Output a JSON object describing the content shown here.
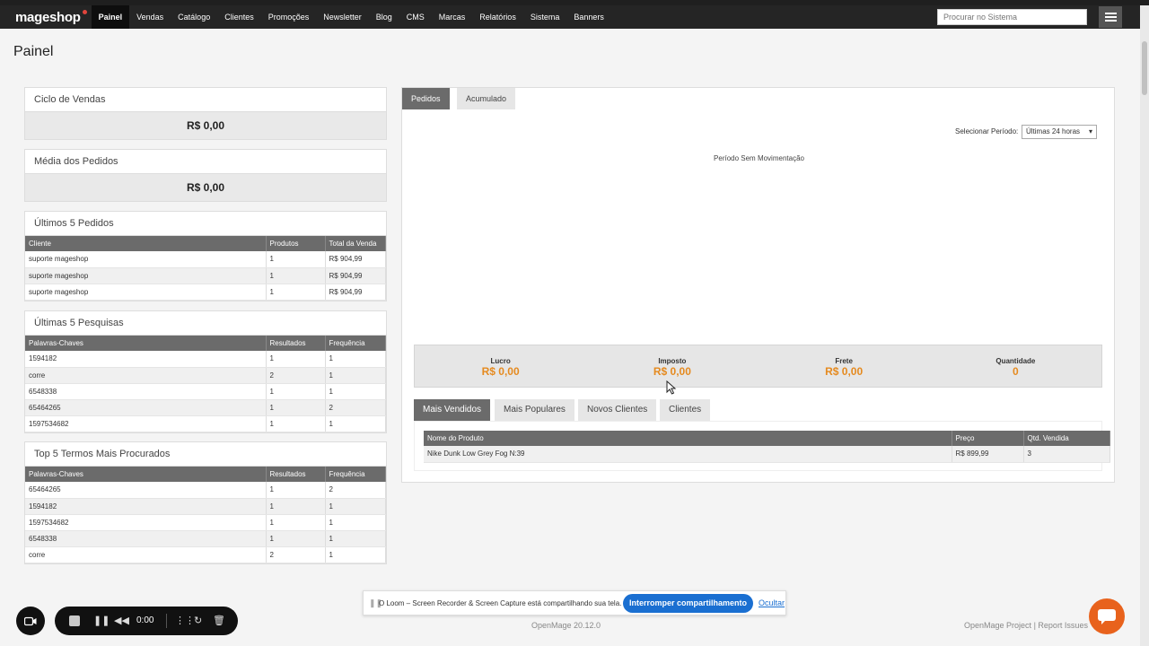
{
  "app": {
    "logo": "mageshop"
  },
  "nav": {
    "items": [
      "Painel",
      "Vendas",
      "Catálogo",
      "Clientes",
      "Promoções",
      "Newsletter",
      "Blog",
      "CMS",
      "Marcas",
      "Relatórios",
      "Sistema",
      "Banners"
    ],
    "active": "Painel",
    "search_placeholder": "Procurar no Sistema"
  },
  "page_title": "Painel",
  "sales_cycle": {
    "title": "Ciclo de Vendas",
    "value": "R$ 0,00"
  },
  "avg_orders": {
    "title": "Média dos Pedidos",
    "value": "R$ 0,00"
  },
  "last_orders": {
    "title": "Últimos 5 Pedidos",
    "columns": [
      "Cliente",
      "Produtos",
      "Total da Venda"
    ],
    "rows": [
      [
        "suporte mageshop",
        "1",
        "R$ 904,99"
      ],
      [
        "suporte mageshop",
        "1",
        "R$ 904,99"
      ],
      [
        "suporte mageshop",
        "1",
        "R$ 904,99"
      ]
    ]
  },
  "last_searches": {
    "title": "Últimas 5 Pesquisas",
    "columns": [
      "Palavras-Chaves",
      "Resultados",
      "Frequência"
    ],
    "rows": [
      [
        "1594182",
        "1",
        "1"
      ],
      [
        "corre",
        "2",
        "1"
      ],
      [
        "6548338",
        "1",
        "1"
      ],
      [
        "65464265",
        "1",
        "2"
      ],
      [
        "1597534682",
        "1",
        "1"
      ]
    ]
  },
  "top_terms": {
    "title": "Top 5 Termos Mais Procurados",
    "columns": [
      "Palavras-Chaves",
      "Resultados",
      "Frequência"
    ],
    "rows": [
      [
        "65464265",
        "1",
        "2"
      ],
      [
        "1594182",
        "1",
        "1"
      ],
      [
        "1597534682",
        "1",
        "1"
      ],
      [
        "6548338",
        "1",
        "1"
      ],
      [
        "corre",
        "2",
        "1"
      ]
    ]
  },
  "chart_panel": {
    "tabs": [
      "Pedidos",
      "Acumulado"
    ],
    "active_tab": "Pedidos",
    "period_label": "Selecionar Período:",
    "period_value": "Últimas 24 horas",
    "empty_message": "Período Sem Movimentação",
    "totals": [
      {
        "label": "Lucro",
        "value": "R$ 0,00"
      },
      {
        "label": "Imposto",
        "value": "R$ 0,00"
      },
      {
        "label": "Frete",
        "value": "R$ 0,00"
      },
      {
        "label": "Quantidade",
        "value": "0"
      }
    ],
    "accent_color": "#e58a1f"
  },
  "product_tabs": {
    "tabs": [
      "Mais Vendidos",
      "Mais Populares",
      "Novos Clientes",
      "Clientes"
    ],
    "active_tab": "Mais Vendidos",
    "columns": [
      "Nome do Produto",
      "Preço",
      "Qtd. Vendida"
    ],
    "rows": [
      [
        "Nike Dunk Low Grey Fog N:39",
        "R$ 899,99",
        "3"
      ]
    ]
  },
  "footer": {
    "version": "OpenMage 20.12.0",
    "project_link": "OpenMage Project",
    "separator": "|",
    "issues_link": "Report Issues"
  },
  "loom": {
    "timer": "0:00",
    "share_message": "O Loom – Screen Recorder & Screen Capture está compartilhando sua tela.",
    "stop_button": "Interromper compartilhamento",
    "hide_link": "Ocultar",
    "brand_color": "#1a6fd1"
  },
  "chat": {
    "icon": "chat-icon",
    "color": "#e8621c"
  }
}
